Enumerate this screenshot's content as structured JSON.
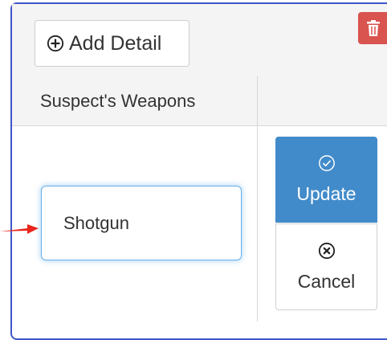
{
  "toolbar": {
    "add_detail_label": "Add Detail",
    "add_icon": "plus-circle-icon",
    "delete_icon": "trash-icon"
  },
  "table": {
    "columns": [
      "Suspect's Weapons",
      ""
    ]
  },
  "editor": {
    "weapon_value": "Shotgun",
    "update_label": "Update",
    "update_icon": "check-circle-icon",
    "cancel_label": "Cancel",
    "cancel_icon": "x-circle-icon"
  },
  "colors": {
    "frame_border": "#3f57c9",
    "primary": "#428bca",
    "danger": "#d9534f",
    "focus": "#66afe9",
    "arrow": "#e8261c"
  }
}
